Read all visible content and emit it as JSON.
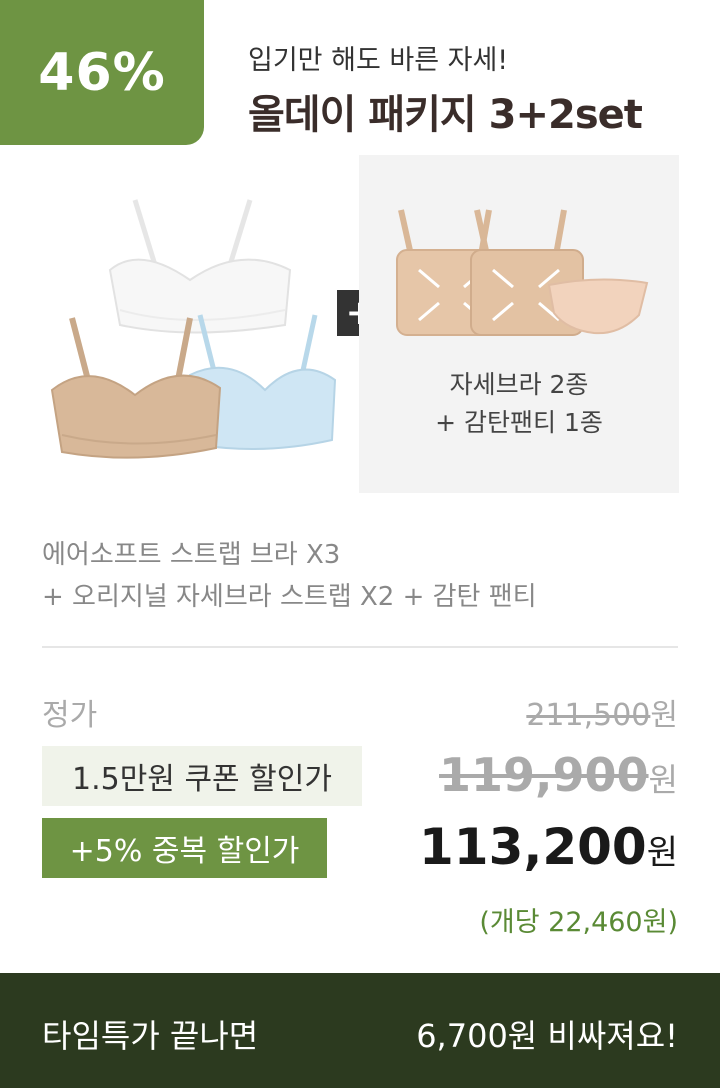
{
  "badge": {
    "discount": "46%"
  },
  "header": {
    "subtitle": "입기만 해도 바른 자세!",
    "title": "올데이 패키지 3+2set"
  },
  "products": {
    "plus_symbol": "+",
    "panel_line1": "자세브라 2종",
    "panel_line2": "+ 감탄팬티 1종"
  },
  "description": {
    "line1": "에어소프트 스트랩 브라 X3",
    "line2": "+ 오리지널 자세브라 스트랩 X2 + 감탄 팬티"
  },
  "pricing": {
    "regular_label": "정가",
    "regular_price": "211,500",
    "currency": "원",
    "coupon_label": "1.5만원 쿠폰 할인가",
    "coupon_price": "119,900",
    "extra_label": "+5% 중복 할인가",
    "final_price": "113,200",
    "per_unit": "(개당 22,460원)"
  },
  "footer": {
    "left_text": "타임특가 끝나면",
    "right_text": "6,700원 비싸져요!"
  },
  "colors": {
    "accent_green": "#6e9443",
    "footer_bg": "#2c3a1f",
    "per_unit_text": "#5a8a35"
  }
}
